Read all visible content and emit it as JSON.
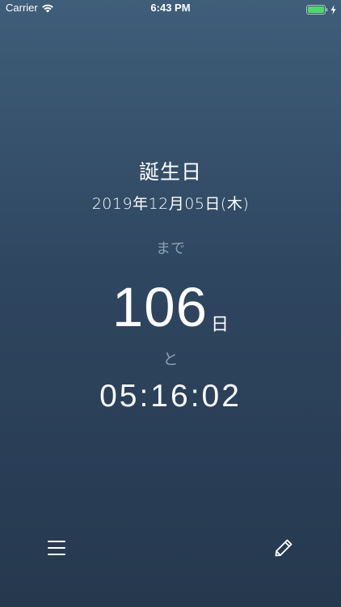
{
  "status_bar": {
    "carrier": "Carrier",
    "time": "6:43 PM",
    "wifi_icon": "wifi-icon",
    "battery_icon": "battery-full-icon",
    "charging_icon": "charging-bolt-icon",
    "battery_color": "#4cd964"
  },
  "event": {
    "title": "誕生日",
    "date": "2019年12月05日(木)"
  },
  "countdown": {
    "until_label": "まで",
    "days": "106",
    "days_unit": "日",
    "and_label": "と",
    "time": "05:16:02"
  },
  "toolbar": {
    "menu_icon": "menu-icon",
    "edit_icon": "pencil-icon"
  },
  "colors": {
    "background_top": "#3f5e79",
    "background_bottom": "#25384e",
    "text_primary": "#ffffff",
    "text_secondary": "#8ea0b3"
  }
}
